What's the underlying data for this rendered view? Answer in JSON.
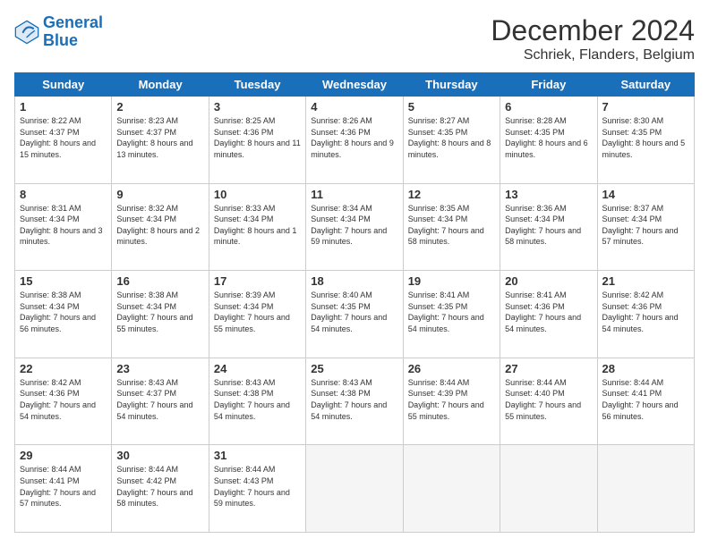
{
  "logo": {
    "line1": "General",
    "line2": "Blue"
  },
  "title": "December 2024",
  "subtitle": "Schriek, Flanders, Belgium",
  "days_header": [
    "Sunday",
    "Monday",
    "Tuesday",
    "Wednesday",
    "Thursday",
    "Friday",
    "Saturday"
  ],
  "weeks": [
    [
      {
        "day": "1",
        "sunrise": "8:22 AM",
        "sunset": "4:37 PM",
        "daylight": "8 hours and 15 minutes."
      },
      {
        "day": "2",
        "sunrise": "8:23 AM",
        "sunset": "4:37 PM",
        "daylight": "8 hours and 13 minutes."
      },
      {
        "day": "3",
        "sunrise": "8:25 AM",
        "sunset": "4:36 PM",
        "daylight": "8 hours and 11 minutes."
      },
      {
        "day": "4",
        "sunrise": "8:26 AM",
        "sunset": "4:36 PM",
        "daylight": "8 hours and 9 minutes."
      },
      {
        "day": "5",
        "sunrise": "8:27 AM",
        "sunset": "4:35 PM",
        "daylight": "8 hours and 8 minutes."
      },
      {
        "day": "6",
        "sunrise": "8:28 AM",
        "sunset": "4:35 PM",
        "daylight": "8 hours and 6 minutes."
      },
      {
        "day": "7",
        "sunrise": "8:30 AM",
        "sunset": "4:35 PM",
        "daylight": "8 hours and 5 minutes."
      }
    ],
    [
      {
        "day": "8",
        "sunrise": "8:31 AM",
        "sunset": "4:34 PM",
        "daylight": "8 hours and 3 minutes."
      },
      {
        "day": "9",
        "sunrise": "8:32 AM",
        "sunset": "4:34 PM",
        "daylight": "8 hours and 2 minutes."
      },
      {
        "day": "10",
        "sunrise": "8:33 AM",
        "sunset": "4:34 PM",
        "daylight": "8 hours and 1 minute."
      },
      {
        "day": "11",
        "sunrise": "8:34 AM",
        "sunset": "4:34 PM",
        "daylight": "7 hours and 59 minutes."
      },
      {
        "day": "12",
        "sunrise": "8:35 AM",
        "sunset": "4:34 PM",
        "daylight": "7 hours and 58 minutes."
      },
      {
        "day": "13",
        "sunrise": "8:36 AM",
        "sunset": "4:34 PM",
        "daylight": "7 hours and 58 minutes."
      },
      {
        "day": "14",
        "sunrise": "8:37 AM",
        "sunset": "4:34 PM",
        "daylight": "7 hours and 57 minutes."
      }
    ],
    [
      {
        "day": "15",
        "sunrise": "8:38 AM",
        "sunset": "4:34 PM",
        "daylight": "7 hours and 56 minutes."
      },
      {
        "day": "16",
        "sunrise": "8:38 AM",
        "sunset": "4:34 PM",
        "daylight": "7 hours and 55 minutes."
      },
      {
        "day": "17",
        "sunrise": "8:39 AM",
        "sunset": "4:34 PM",
        "daylight": "7 hours and 55 minutes."
      },
      {
        "day": "18",
        "sunrise": "8:40 AM",
        "sunset": "4:35 PM",
        "daylight": "7 hours and 54 minutes."
      },
      {
        "day": "19",
        "sunrise": "8:41 AM",
        "sunset": "4:35 PM",
        "daylight": "7 hours and 54 minutes."
      },
      {
        "day": "20",
        "sunrise": "8:41 AM",
        "sunset": "4:36 PM",
        "daylight": "7 hours and 54 minutes."
      },
      {
        "day": "21",
        "sunrise": "8:42 AM",
        "sunset": "4:36 PM",
        "daylight": "7 hours and 54 minutes."
      }
    ],
    [
      {
        "day": "22",
        "sunrise": "8:42 AM",
        "sunset": "4:36 PM",
        "daylight": "7 hours and 54 minutes."
      },
      {
        "day": "23",
        "sunrise": "8:43 AM",
        "sunset": "4:37 PM",
        "daylight": "7 hours and 54 minutes."
      },
      {
        "day": "24",
        "sunrise": "8:43 AM",
        "sunset": "4:38 PM",
        "daylight": "7 hours and 54 minutes."
      },
      {
        "day": "25",
        "sunrise": "8:43 AM",
        "sunset": "4:38 PM",
        "daylight": "7 hours and 54 minutes."
      },
      {
        "day": "26",
        "sunrise": "8:44 AM",
        "sunset": "4:39 PM",
        "daylight": "7 hours and 55 minutes."
      },
      {
        "day": "27",
        "sunrise": "8:44 AM",
        "sunset": "4:40 PM",
        "daylight": "7 hours and 55 minutes."
      },
      {
        "day": "28",
        "sunrise": "8:44 AM",
        "sunset": "4:41 PM",
        "daylight": "7 hours and 56 minutes."
      }
    ],
    [
      {
        "day": "29",
        "sunrise": "8:44 AM",
        "sunset": "4:41 PM",
        "daylight": "7 hours and 57 minutes."
      },
      {
        "day": "30",
        "sunrise": "8:44 AM",
        "sunset": "4:42 PM",
        "daylight": "7 hours and 58 minutes."
      },
      {
        "day": "31",
        "sunrise": "8:44 AM",
        "sunset": "4:43 PM",
        "daylight": "7 hours and 59 minutes."
      },
      null,
      null,
      null,
      null
    ]
  ]
}
